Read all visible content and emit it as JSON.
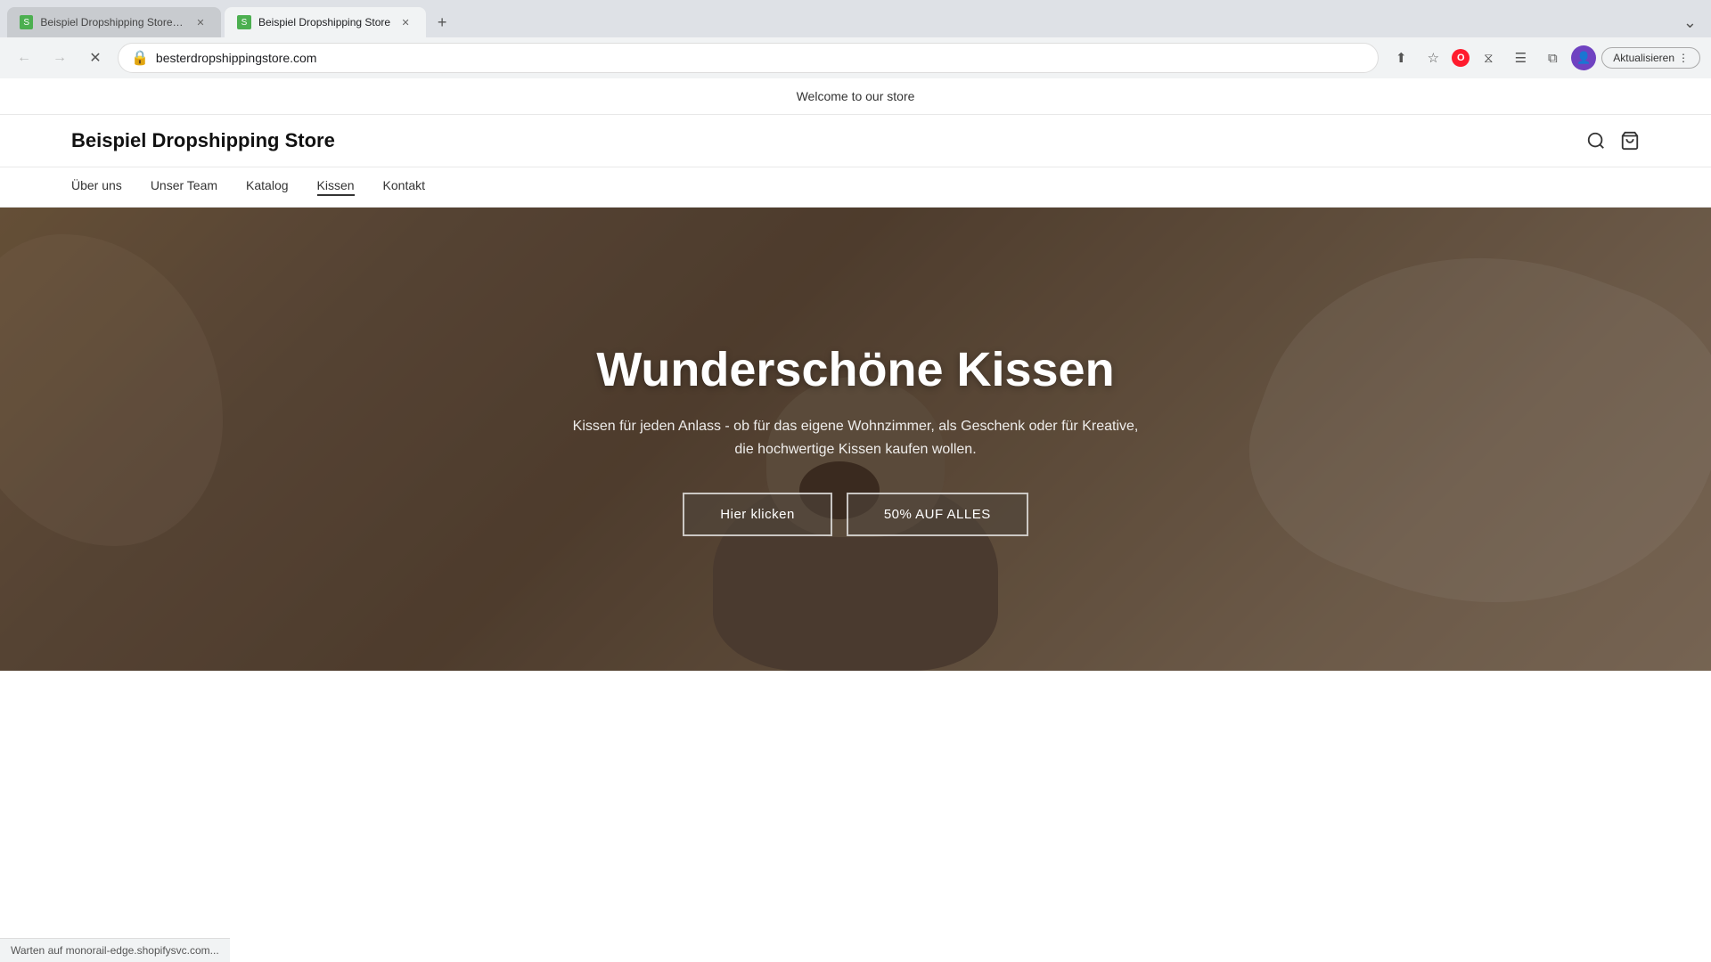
{
  "browser": {
    "tabs": [
      {
        "id": "tab1",
        "label": "Beispiel Dropshipping Store · ...",
        "favicon": "S",
        "active": false,
        "closable": true
      },
      {
        "id": "tab2",
        "label": "Beispiel Dropshipping Store",
        "favicon": "S",
        "active": true,
        "closable": true
      }
    ],
    "new_tab_icon": "+",
    "tab_bar_right": "⌄",
    "nav": {
      "back_icon": "←",
      "forward_icon": "→",
      "stop_icon": "✕",
      "reload_icon": "↻"
    },
    "url": "besterdropshippingstore.com",
    "lock_icon": "🔒",
    "actions": {
      "share_icon": "⬆",
      "bookmark_icon": "☆",
      "opera_label": "O",
      "extensions_icon": "⧖",
      "menu_icon": "☰",
      "split_icon": "⧉",
      "profile_icon": "👤",
      "update_label": "Aktualisieren",
      "update_menu": "⋮"
    }
  },
  "site": {
    "announcement": "Welcome to our store",
    "logo": "Beispiel Dropshipping Store",
    "nav_links": [
      {
        "label": "Über uns",
        "active": false
      },
      {
        "label": "Unser Team",
        "active": false
      },
      {
        "label": "Katalog",
        "active": false
      },
      {
        "label": "Kissen",
        "active": true
      },
      {
        "label": "Kontakt",
        "active": false
      }
    ],
    "search_icon": "search",
    "cart_icon": "cart",
    "hero": {
      "title": "Wunderschöne Kissen",
      "subtitle": "Kissen für jeden Anlass - ob für das eigene Wohnzimmer, als Geschenk oder für Kreative, die hochwertige Kissen kaufen wollen.",
      "btn1": "Hier klicken",
      "btn2": "50% AUF ALLES"
    }
  },
  "status_bar": {
    "text": "Warten auf monorail-edge.shopifysvc.com..."
  }
}
